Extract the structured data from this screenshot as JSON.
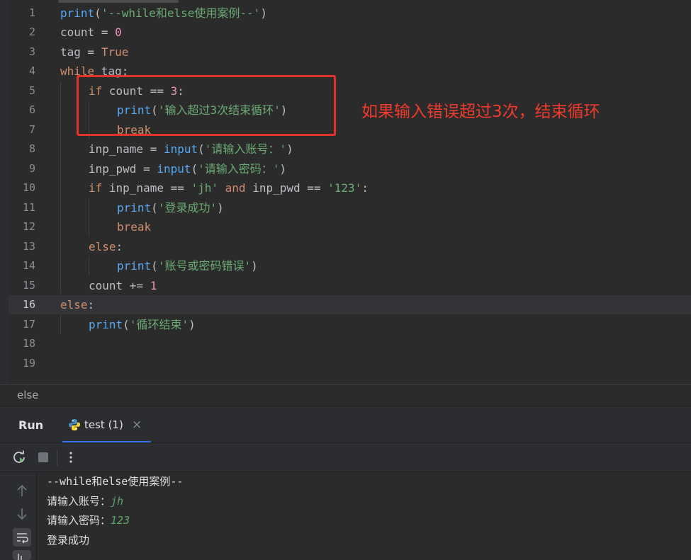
{
  "editor": {
    "line_numbers": [
      "1",
      "2",
      "3",
      "4",
      "5",
      "6",
      "7",
      "8",
      "9",
      "10",
      "11",
      "12",
      "13",
      "14",
      "15",
      "16",
      "17",
      "18",
      "19"
    ],
    "current_line": "16",
    "code": {
      "l1": {
        "fn": "print",
        "p1": "(",
        "str": "'--while和else使用案例--'",
        "p2": ")"
      },
      "l2": {
        "id": "count",
        "op": " = ",
        "num": "0"
      },
      "l3": {
        "id": "tag",
        "op": " = ",
        "kw": "True"
      },
      "l4": {
        "kw": "while",
        "rest": " tag:"
      },
      "l5": {
        "kw": "if",
        "rest": " count == ",
        "num": "3",
        "colon": ":"
      },
      "l6": {
        "fn": "print",
        "p1": "(",
        "str": "'输入超过3次结束循环'",
        "p2": ")"
      },
      "l7": {
        "kw": "break"
      },
      "l8": {
        "id": "inp_name = ",
        "fn": "input",
        "p1": "(",
        "str": "'请输入账号：'",
        "p2": ")"
      },
      "l9": {
        "id": "inp_pwd = ",
        "fn": "input",
        "p1": "(",
        "str": "'请输入密码：'",
        "p2": ")"
      },
      "l10": {
        "kw": "if",
        "rest1": " inp_name == ",
        "str1": "'jh'",
        "kw2": " and",
        "rest2": " inp_pwd == ",
        "str2": "'123'",
        "colon": ":"
      },
      "l11": {
        "fn": "print",
        "p1": "(",
        "str": "'登录成功'",
        "p2": ")"
      },
      "l12": {
        "kw": "break"
      },
      "l13": {
        "kw": "else",
        "colon": ":"
      },
      "l14": {
        "fn": "print",
        "p1": "(",
        "str": "'账号或密码错误'",
        "p2": ")"
      },
      "l15": {
        "id": "count += ",
        "num": "1"
      },
      "l16": {
        "kw": "else",
        "colon": ":"
      },
      "l17": {
        "fn": "print",
        "p1": "(",
        "str": "'循环结束'",
        "p2": ")"
      }
    },
    "annotation": "如果输入错误超过3次，结束循环"
  },
  "breadcrumb": "else",
  "run_panel": {
    "title": "Run",
    "tab_label": "test (1)",
    "tab_close": "×",
    "console_lines": [
      {
        "text": "--while和else使用案例--",
        "input": ""
      },
      {
        "text": "请输入账号：",
        "input": "jh"
      },
      {
        "text": "请输入密码：",
        "input": "123"
      },
      {
        "text": "登录成功",
        "input": ""
      }
    ]
  },
  "icons": [
    "rerun-icon",
    "stop-icon",
    "more-icon",
    "python-icon",
    "scroll-up-icon",
    "scroll-down-icon",
    "soft-wrap-icon",
    "scroll-to-end-icon"
  ],
  "colors": {
    "keyword": "#cf8e6d",
    "function": "#56a8f5",
    "string": "#6aab73",
    "number": "#2aacb8",
    "annotation": "#e0332e",
    "accent": "#3574f0"
  }
}
